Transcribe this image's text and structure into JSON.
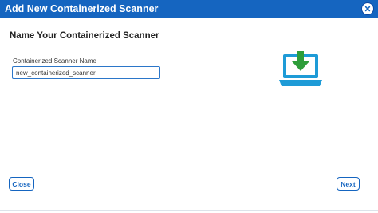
{
  "dialog": {
    "title": "Add New Containerized Scanner",
    "close_icon": "close-icon"
  },
  "step": {
    "heading": "Name Your Containerized Scanner"
  },
  "form": {
    "name_label": "Containerized Scanner Name",
    "name_value": "new_containerized_scanner"
  },
  "illustration": {
    "icon": "laptop-download-icon",
    "colors": {
      "laptop": "#1e9bd7",
      "arrow": "#2e9d3a"
    }
  },
  "footer": {
    "close_label": "Close",
    "next_label": "Next"
  },
  "colors": {
    "titlebar": "#1565c0",
    "accent": "#1565c0"
  }
}
